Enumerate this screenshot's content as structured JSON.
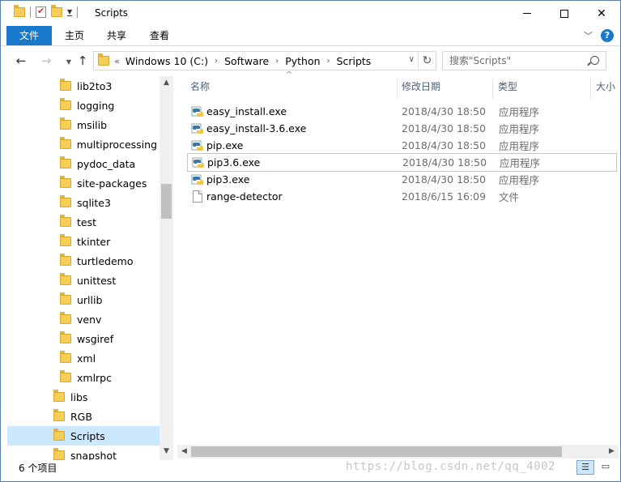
{
  "window": {
    "title": "Scripts"
  },
  "ribbon": {
    "tabs": [
      "文件",
      "主页",
      "共享",
      "查看"
    ]
  },
  "address": {
    "overflow": "«",
    "crumbs": [
      "Windows 10 (C:)",
      "Software",
      "Python",
      "Scripts"
    ]
  },
  "search": {
    "placeholder": "搜索\"Scripts\""
  },
  "nav_tree": [
    {
      "label": "lib2to3",
      "selected": false
    },
    {
      "label": "logging",
      "selected": false
    },
    {
      "label": "msilib",
      "selected": false
    },
    {
      "label": "multiprocessing",
      "selected": false
    },
    {
      "label": "pydoc_data",
      "selected": false
    },
    {
      "label": "site-packages",
      "selected": false
    },
    {
      "label": "sqlite3",
      "selected": false
    },
    {
      "label": "test",
      "selected": false
    },
    {
      "label": "tkinter",
      "selected": false
    },
    {
      "label": "turtledemo",
      "selected": false
    },
    {
      "label": "unittest",
      "selected": false
    },
    {
      "label": "urllib",
      "selected": false
    },
    {
      "label": "venv",
      "selected": false
    },
    {
      "label": "wsgiref",
      "selected": false
    },
    {
      "label": "xml",
      "selected": false
    },
    {
      "label": "xmlrpc",
      "selected": false
    },
    {
      "label": "libs",
      "selected": false
    },
    {
      "label": "RGB",
      "selected": false
    },
    {
      "label": "Scripts",
      "selected": true
    },
    {
      "label": "snapshot",
      "selected": false
    }
  ],
  "columns": [
    "名称",
    "修改日期",
    "类型",
    "大小"
  ],
  "files": [
    {
      "name": "easy_install.exe",
      "date": "2018/4/30 18:50",
      "type": "应用程序",
      "icon": "python-exe-icon"
    },
    {
      "name": "easy_install-3.6.exe",
      "date": "2018/4/30 18:50",
      "type": "应用程序",
      "icon": "python-exe-icon"
    },
    {
      "name": "pip.exe",
      "date": "2018/4/30 18:50",
      "type": "应用程序",
      "icon": "python-exe-icon"
    },
    {
      "name": "pip3.6.exe",
      "date": "2018/4/30 18:50",
      "type": "应用程序",
      "icon": "python-exe-icon"
    },
    {
      "name": "pip3.exe",
      "date": "2018/4/30 18:50",
      "type": "应用程序",
      "icon": "python-exe-icon"
    },
    {
      "name": "range-detector",
      "date": "2018/6/15 16:09",
      "type": "文件",
      "icon": "file-icon"
    }
  ],
  "status": {
    "item_count": "6 个项目"
  },
  "watermark": "https://blog.csdn.net/qq_4002",
  "colors": {
    "accent": "#1979ca",
    "selection": "#cce8ff",
    "folder": "#f5cd59"
  }
}
